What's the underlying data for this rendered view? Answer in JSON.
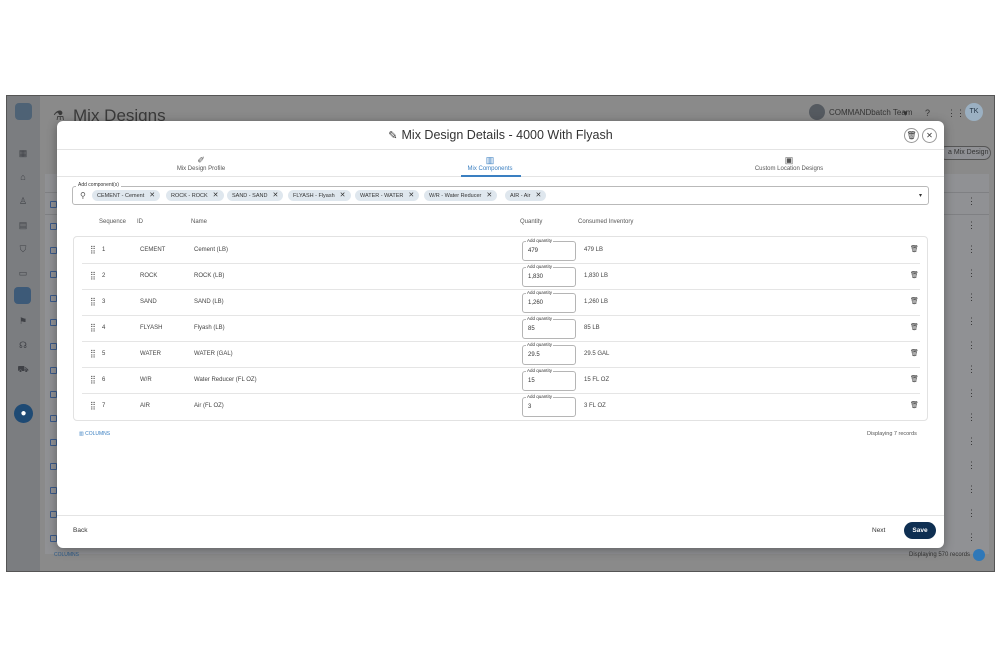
{
  "background": {
    "page_title": "Mix Designs",
    "team_name": "COMMANDbatch Team",
    "user_initials": "TK",
    "add_button_label": "a Mix Design",
    "columns_label": "COLUMNS",
    "records_label": "Displaying 570 records"
  },
  "modal": {
    "title": "Mix Design Details - 4000 With Flyash",
    "tabs": [
      {
        "label": "Mix Design Profile",
        "icon": "edit-icon"
      },
      {
        "label": "Mix Components",
        "icon": "grid-icon",
        "active": true
      },
      {
        "label": "Custom Location Designs",
        "icon": "calendar-icon"
      }
    ],
    "components_field": {
      "legend": "Add component(s)",
      "chips": [
        "CEMENT - Cement",
        "ROCK - ROCK",
        "SAND - SAND",
        "FLYASH - Flyash",
        "WATER - WATER",
        "W/R - Water Reducer",
        "AIR - Air"
      ]
    },
    "columns": {
      "sequence": "Sequence",
      "id": "ID",
      "name": "Name",
      "quantity": "Quantity",
      "consumed": "Consumed Inventory"
    },
    "quantity_label": "Add quantity",
    "rows": [
      {
        "seq": "1",
        "id": "CEMENT",
        "name": "Cement (LB)",
        "qty": "479",
        "consumed": "479 LB"
      },
      {
        "seq": "2",
        "id": "ROCK",
        "name": "ROCK (LB)",
        "qty": "1,830",
        "consumed": "1,830 LB"
      },
      {
        "seq": "3",
        "id": "SAND",
        "name": "SAND (LB)",
        "qty": "1,260",
        "consumed": "1,260 LB"
      },
      {
        "seq": "4",
        "id": "FLYASH",
        "name": "Flyash (LB)",
        "qty": "85",
        "consumed": "85 LB"
      },
      {
        "seq": "5",
        "id": "WATER",
        "name": "WATER (GAL)",
        "qty": "29.5",
        "consumed": "29.5 GAL"
      },
      {
        "seq": "6",
        "id": "W/R",
        "name": "Water Reducer (FL OZ)",
        "qty": "15",
        "consumed": "15 FL OZ"
      },
      {
        "seq": "7",
        "id": "AIR",
        "name": "Air (FL OZ)",
        "qty": "3",
        "consumed": "3 FL OZ"
      }
    ],
    "columns_button": "COLUMNS",
    "records_text": "Displaying 7 records",
    "back_label": "Back",
    "next_label": "Next",
    "save_label": "Save"
  }
}
